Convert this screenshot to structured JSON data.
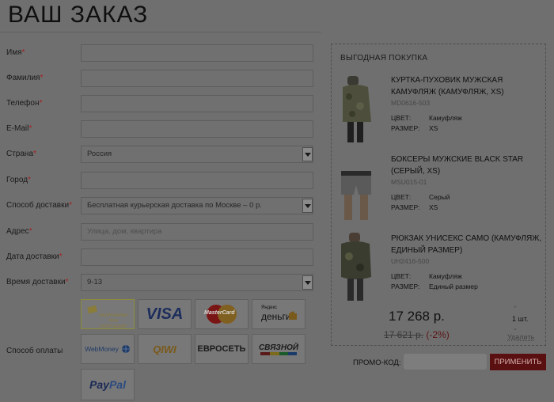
{
  "page_title": "ВАШ ЗАКАЗ",
  "required_mark": "*",
  "form": {
    "name_label": "Имя",
    "surname_label": "Фамилия",
    "phone_label": "Телефон",
    "email_label": "E-Mail",
    "country_label": "Страна",
    "country_value": "Россия",
    "city_label": "Город",
    "delivery_method_label": "Способ доставки",
    "delivery_method_value": "Бесплатная курьерская доставка по Москве – 0 р.",
    "address_label": "Адрес",
    "address_placeholder": "Улица, дом, квартира",
    "delivery_date_label": "Дата доставки",
    "delivery_time_label": "Время доставки",
    "delivery_time_value": "9-13",
    "payment_label": "Способ оплаты"
  },
  "payment_methods": {
    "cash_line1": "НАЛИЧНЫМИ",
    "cash_line2": "ПРИ ПОЛУЧЕНИИ",
    "visa": "VISA",
    "mastercard": "MasterCard",
    "yandex_top": "Яндекс",
    "yandex_bottom": "деньги",
    "webmoney": "WebMoney",
    "qiwi": "QIWI",
    "euroset": "ЕВРОСЕТЬ",
    "svyaznoy": "СВЯЗНОЙ",
    "paypal_pay": "Pay",
    "paypal_pal": "Pal"
  },
  "cart": {
    "title": "ВЫГОДНАЯ ПОКУПКА",
    "color_label": "ЦВЕТ:",
    "size_label": "РАЗМЕР:",
    "items": [
      {
        "name": "КУРТКА-ПУХОВИК МУЖСКАЯ КАМУФЛЯЖ (КАМУФЛЯЖ, XS)",
        "sku": "MD0616-503",
        "color": "Камуфляж",
        "size": "XS"
      },
      {
        "name": "БОКСЕРЫ МУЖСКИЕ BLACK STAR (СЕРЫЙ, XS)",
        "sku": "MSU015-01",
        "color": "Серый",
        "size": "XS"
      },
      {
        "name": "РЮКЗАК УНИСЕКС CAMO (КАМУФЛЯЖ, ЕДИНЫЙ РАЗМЕР)",
        "sku": "UH2416-500",
        "color": "Камуфляж",
        "size": "Единый размер"
      }
    ],
    "total": "17 268 р.",
    "old_price": "17 621 р.",
    "discount": "(-2%)",
    "quantity": "1 шт.",
    "remove": "Удалить"
  },
  "promo": {
    "label": "ПРОМО-КОД:",
    "button": "ПРИМЕНИТЬ"
  },
  "colors": {
    "overlay_bg": "#6f6f6f",
    "accent_red": "#5a1010"
  }
}
